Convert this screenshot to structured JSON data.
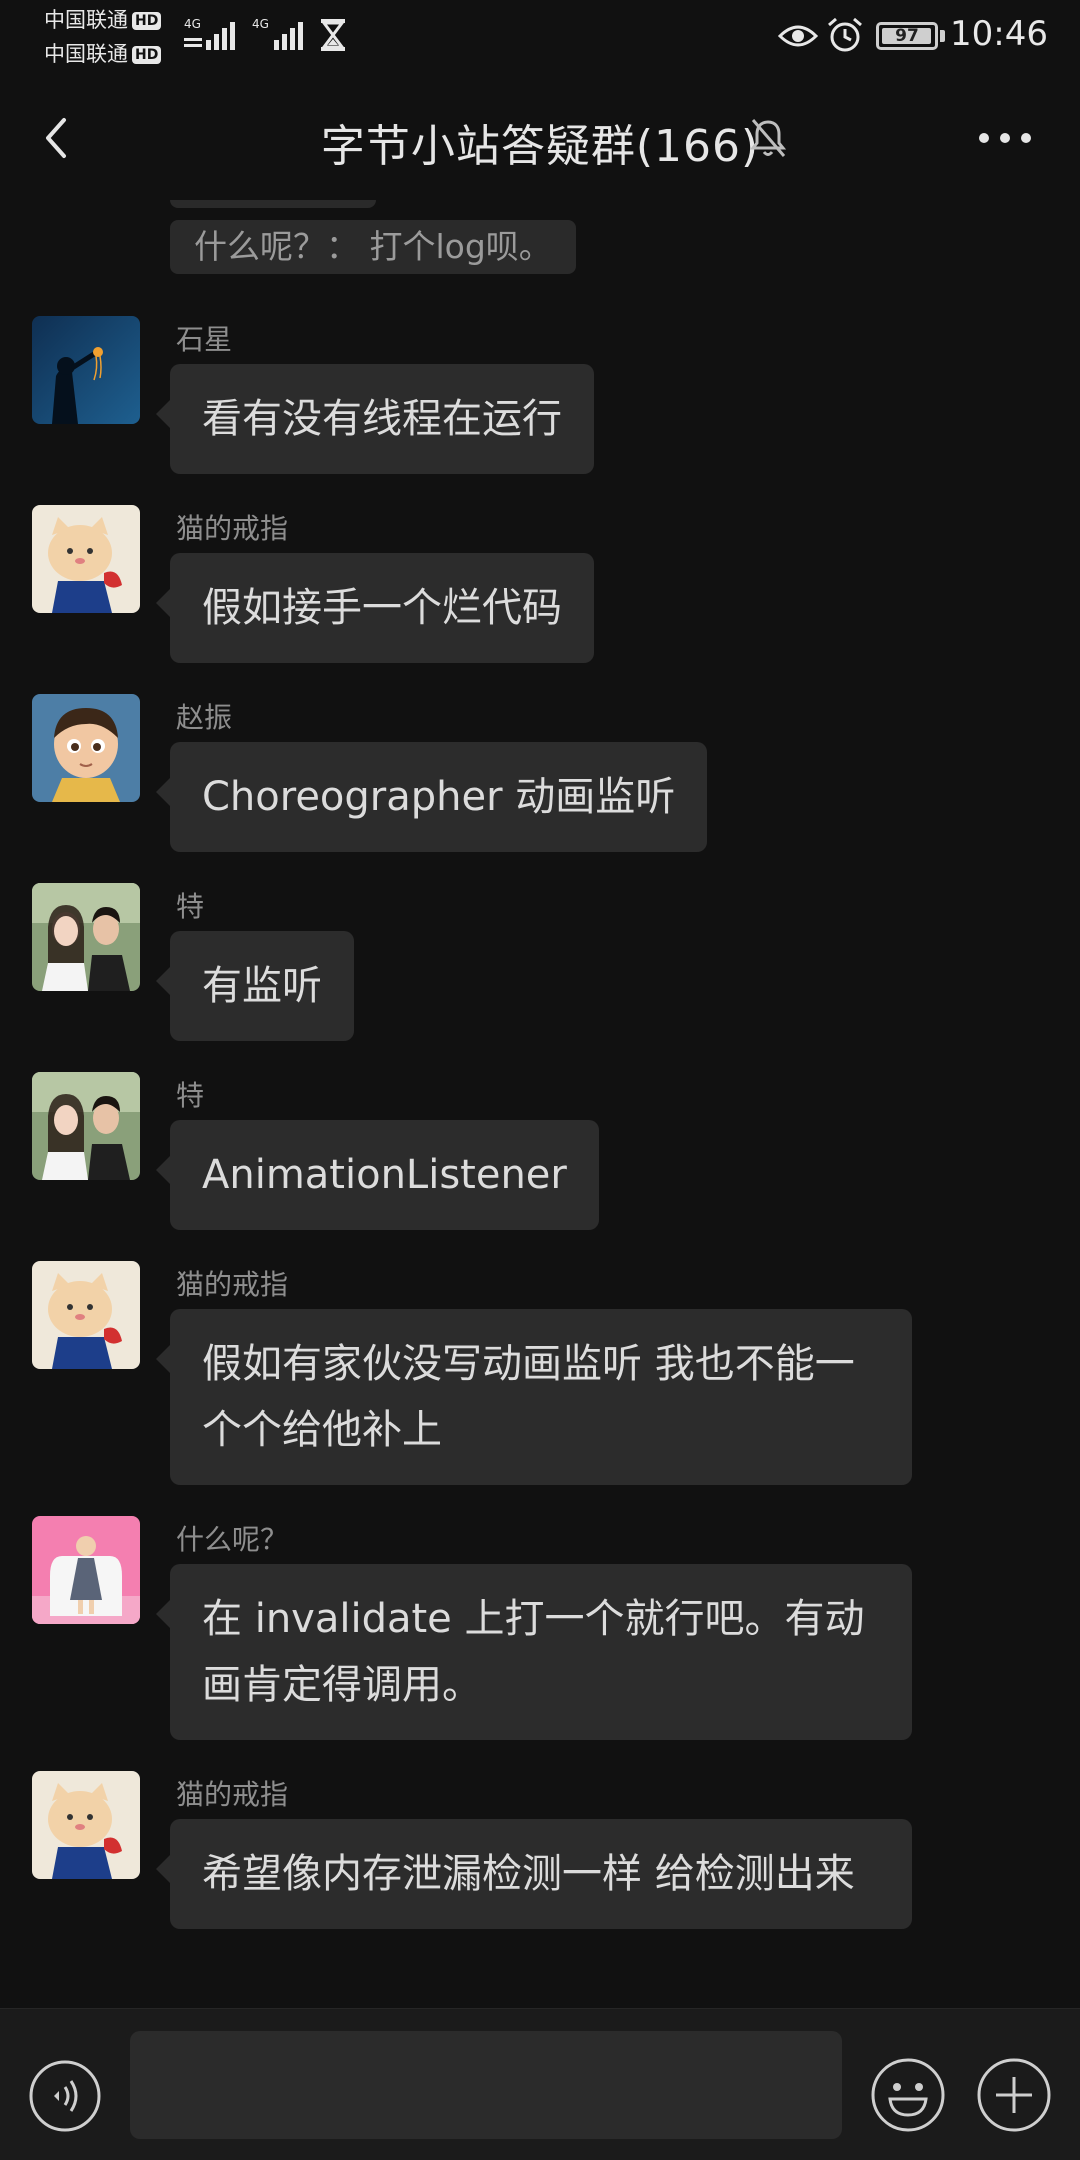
{
  "status": {
    "carrier1": "中国联通",
    "carrier2": "中国联通",
    "hd": "HD",
    "network1": "4G",
    "network2": "4G",
    "battery": "97",
    "battery_level": 0.97,
    "time": "10:46"
  },
  "header": {
    "title": "字节小站答疑群(166)",
    "icons": [
      "back-icon",
      "bell-off-icon",
      "more-icon"
    ]
  },
  "quote": {
    "text": "什么呢？： 打个log呗。"
  },
  "messages": [
    {
      "sender": "石星",
      "text": "看有没有线程在运行",
      "avatar": "avatar-jellyfish"
    },
    {
      "sender": "猫的戒指",
      "text": "假如接手一个烂代码",
      "avatar": "avatar-cat"
    },
    {
      "sender": "赵振",
      "text": "Choreographer 动画监听",
      "avatar": "avatar-boy"
    },
    {
      "sender": "特",
      "text": "有监听",
      "avatar": "avatar-couple"
    },
    {
      "sender": "特",
      "text": "AnimationListener",
      "avatar": "avatar-couple"
    },
    {
      "sender": "猫的戒指",
      "text": "假如有家伙没写动画监听 我也不能一个个给他补上",
      "avatar": "avatar-cat"
    },
    {
      "sender": "什么呢？",
      "text": "在 invalidate 上打一个就行吧。有动画肯定得调用。",
      "avatar": "avatar-child-pink"
    },
    {
      "sender": "猫的戒指",
      "text": "希望像内存泄漏检测一样 给检测出来",
      "avatar": "avatar-cat"
    }
  ],
  "input": {
    "value": "",
    "icons": [
      "voice-icon",
      "emoji-icon",
      "plus-icon"
    ]
  },
  "colors": {
    "background": "#111111",
    "bubble": "#2c2c2c",
    "text": "#dcdcdc",
    "sender": "#8e8e8e"
  }
}
